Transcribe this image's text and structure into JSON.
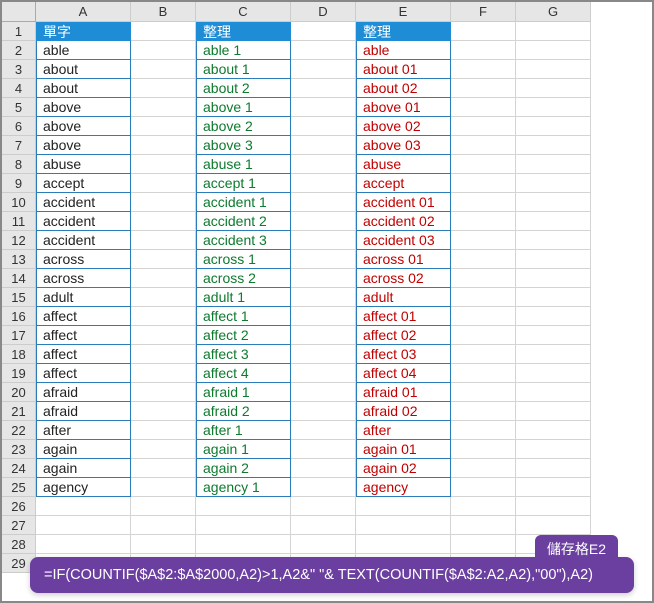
{
  "columns": [
    "A",
    "B",
    "C",
    "D",
    "E",
    "F",
    "G"
  ],
  "rowcount": 29,
  "headers": {
    "A": "單字",
    "C": "整理",
    "E": "整理"
  },
  "colA": [
    "able",
    "about",
    "about",
    "above",
    "above",
    "above",
    "abuse",
    "accept",
    "accident",
    "accident",
    "accident",
    "across",
    "across",
    "adult",
    "affect",
    "affect",
    "affect",
    "affect",
    "afraid",
    "afraid",
    "after",
    "again",
    "again",
    "agency"
  ],
  "colC": [
    "able 1",
    "about 1",
    "about 2",
    "above 1",
    "above 2",
    "above 3",
    "abuse 1",
    "accept 1",
    "accident 1",
    "accident 2",
    "accident 3",
    "across 1",
    "across 2",
    "adult 1",
    "affect 1",
    "affect 2",
    "affect 3",
    "affect 4",
    "afraid 1",
    "afraid 2",
    "after 1",
    "again 1",
    "again 2",
    "agency 1"
  ],
  "colE": [
    "able",
    "about 01",
    "about 02",
    "above 01",
    "above 02",
    "above 03",
    "abuse",
    "accept",
    "accident 01",
    "accident 02",
    "accident 03",
    "across 01",
    "across 02",
    "adult",
    "affect 01",
    "affect 02",
    "affect 03",
    "affect 04",
    "afraid 01",
    "afraid 02",
    "after",
    "again 01",
    "again 02",
    "agency"
  ],
  "formula_tag": "儲存格E2",
  "formula": "=IF(COUNTIF($A$2:$A$2000,A2)>1,A2&\" \"& TEXT(COUNTIF($A$2:A2,A2),\"00\"),A2)",
  "chart_data": {
    "type": "table",
    "title": "Excel worksheet with word list deduplication using COUNTIF formula",
    "columns": [
      "單字 (Word)",
      "整理 (Organized n)",
      "整理 (Organized 0n)"
    ],
    "rows": [
      [
        "able",
        "able 1",
        "able"
      ],
      [
        "about",
        "about 1",
        "about 01"
      ],
      [
        "about",
        "about 2",
        "about 02"
      ],
      [
        "above",
        "above 1",
        "above 01"
      ],
      [
        "above",
        "above 2",
        "above 02"
      ],
      [
        "above",
        "above 3",
        "above 03"
      ],
      [
        "abuse",
        "abuse 1",
        "abuse"
      ],
      [
        "accept",
        "accept 1",
        "accept"
      ],
      [
        "accident",
        "accident 1",
        "accident 01"
      ],
      [
        "accident",
        "accident 2",
        "accident 02"
      ],
      [
        "accident",
        "accident 3",
        "accident 03"
      ],
      [
        "across",
        "across 1",
        "across 01"
      ],
      [
        "across",
        "across 2",
        "across 02"
      ],
      [
        "adult",
        "adult 1",
        "adult"
      ],
      [
        "affect",
        "affect 1",
        "affect 01"
      ],
      [
        "affect",
        "affect 2",
        "affect 02"
      ],
      [
        "affect",
        "affect 3",
        "affect 03"
      ],
      [
        "affect",
        "affect 4",
        "affect 04"
      ],
      [
        "afraid",
        "afraid 1",
        "afraid 01"
      ],
      [
        "afraid",
        "afraid 2",
        "afraid 02"
      ],
      [
        "after",
        "after 1",
        "after"
      ],
      [
        "again",
        "again 1",
        "again 01"
      ],
      [
        "again",
        "again 2",
        "again 02"
      ],
      [
        "agency",
        "agency 1",
        "agency"
      ]
    ],
    "formula_cell": "E2",
    "formula": "=IF(COUNTIF($A$2:$A$2000,A2)>1,A2&\" \"& TEXT(COUNTIF($A$2:A2,A2),\"00\"),A2)"
  }
}
